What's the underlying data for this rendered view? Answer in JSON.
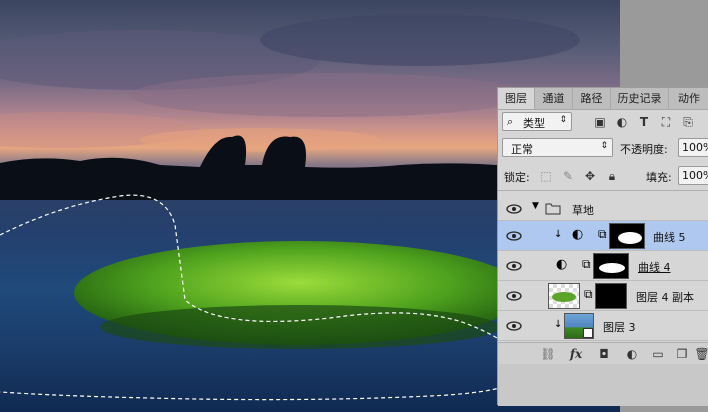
{
  "panel_tabs": [
    "图层",
    "通道",
    "路径",
    "历史记录",
    "动作"
  ],
  "filter": {
    "label": "类型",
    "chevron": "⇕"
  },
  "blend": {
    "mode": "正常",
    "opacity_label": "不透明度:",
    "opacity_value": "100%"
  },
  "lock": {
    "label": "锁定:",
    "fill_label": "填充:",
    "fill_value": "100%"
  },
  "layers": [
    {
      "name": "草地",
      "type": "group"
    },
    {
      "name": "曲线 5",
      "type": "adjustment",
      "selected": true
    },
    {
      "name": "曲线 4",
      "type": "adjustment"
    },
    {
      "name": "图层 4 副本",
      "type": "pixel"
    },
    {
      "name": "图层 3",
      "type": "pixel"
    }
  ],
  "footer_icons": [
    "link-icon",
    "fx-icon",
    "mask-icon",
    "adjustment-icon",
    "folder-icon",
    "new-layer-icon",
    "trash-icon"
  ],
  "colors": {
    "panel_bg": "#d6d6d6",
    "selected_row": "#aec8ef",
    "accent": "#1a5fd1"
  }
}
